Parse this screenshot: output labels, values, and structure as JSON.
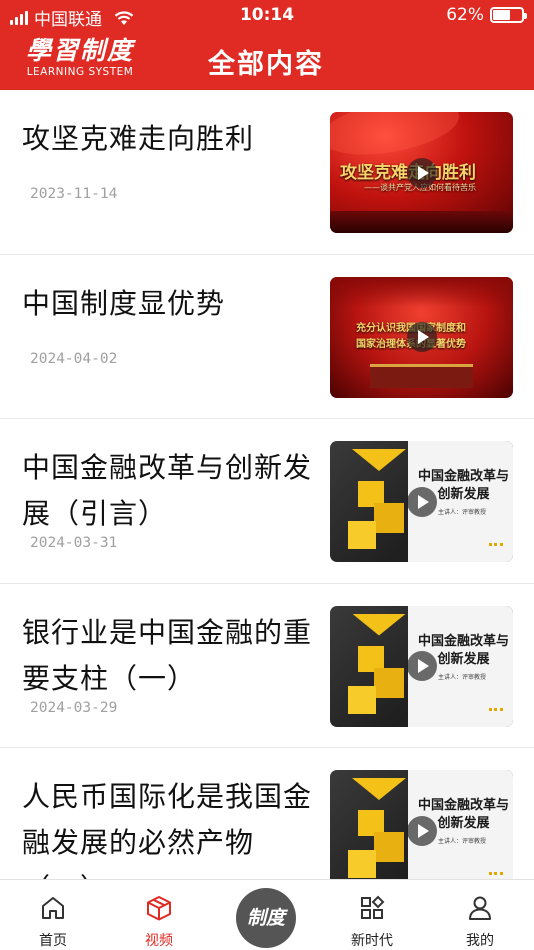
{
  "status_bar": {
    "carrier": "中国联通",
    "time": "10:14",
    "battery": "62%",
    "battery_level": 0.62
  },
  "header": {
    "logo_cn": "學習制度",
    "logo_en": "LEARNING SYSTEM",
    "title": "全部内容"
  },
  "items": [
    {
      "title": "攻坚克难走向胜利",
      "date": "2023-11-14",
      "thumb": {
        "style": "red",
        "overlay_main": "攻坚克难走向胜利",
        "overlay_sub": "——谈共产党人应如何看待苦乐"
      }
    },
    {
      "title": "中国制度显优势",
      "date": "2024-04-02",
      "thumb": {
        "style": "red2",
        "overlay_line1": "充分认识我国国家制度和",
        "overlay_line2": "国家治理体系的显著优势"
      }
    },
    {
      "title": "中国金融改革与创新发展（引言）",
      "date": "2024-03-31",
      "thumb": {
        "style": "dark",
        "panel_title": "中国金融改革与创新发展",
        "panel_sub": "主讲人：评审教授"
      }
    },
    {
      "title": "银行业是中国金融的重要支柱（一）",
      "date": "2024-03-29",
      "thumb": {
        "style": "dark",
        "panel_title": "中国金融改革与创新发展",
        "panel_sub": "主讲人：评审教授"
      }
    },
    {
      "title": "人民币国际化是我国金融发展的必然产物（一）",
      "date": "",
      "thumb": {
        "style": "dark",
        "panel_title": "中国金融改革与创新发展",
        "panel_sub": "主讲人：评审教授"
      }
    }
  ],
  "tabbar": {
    "home": "首页",
    "video": "视频",
    "center": "制度",
    "new_era": "新时代",
    "mine": "我的"
  },
  "colors": {
    "brand_red": "#e02a24",
    "active_tab": "#e02a24",
    "date_gray": "#a0a0a0"
  }
}
